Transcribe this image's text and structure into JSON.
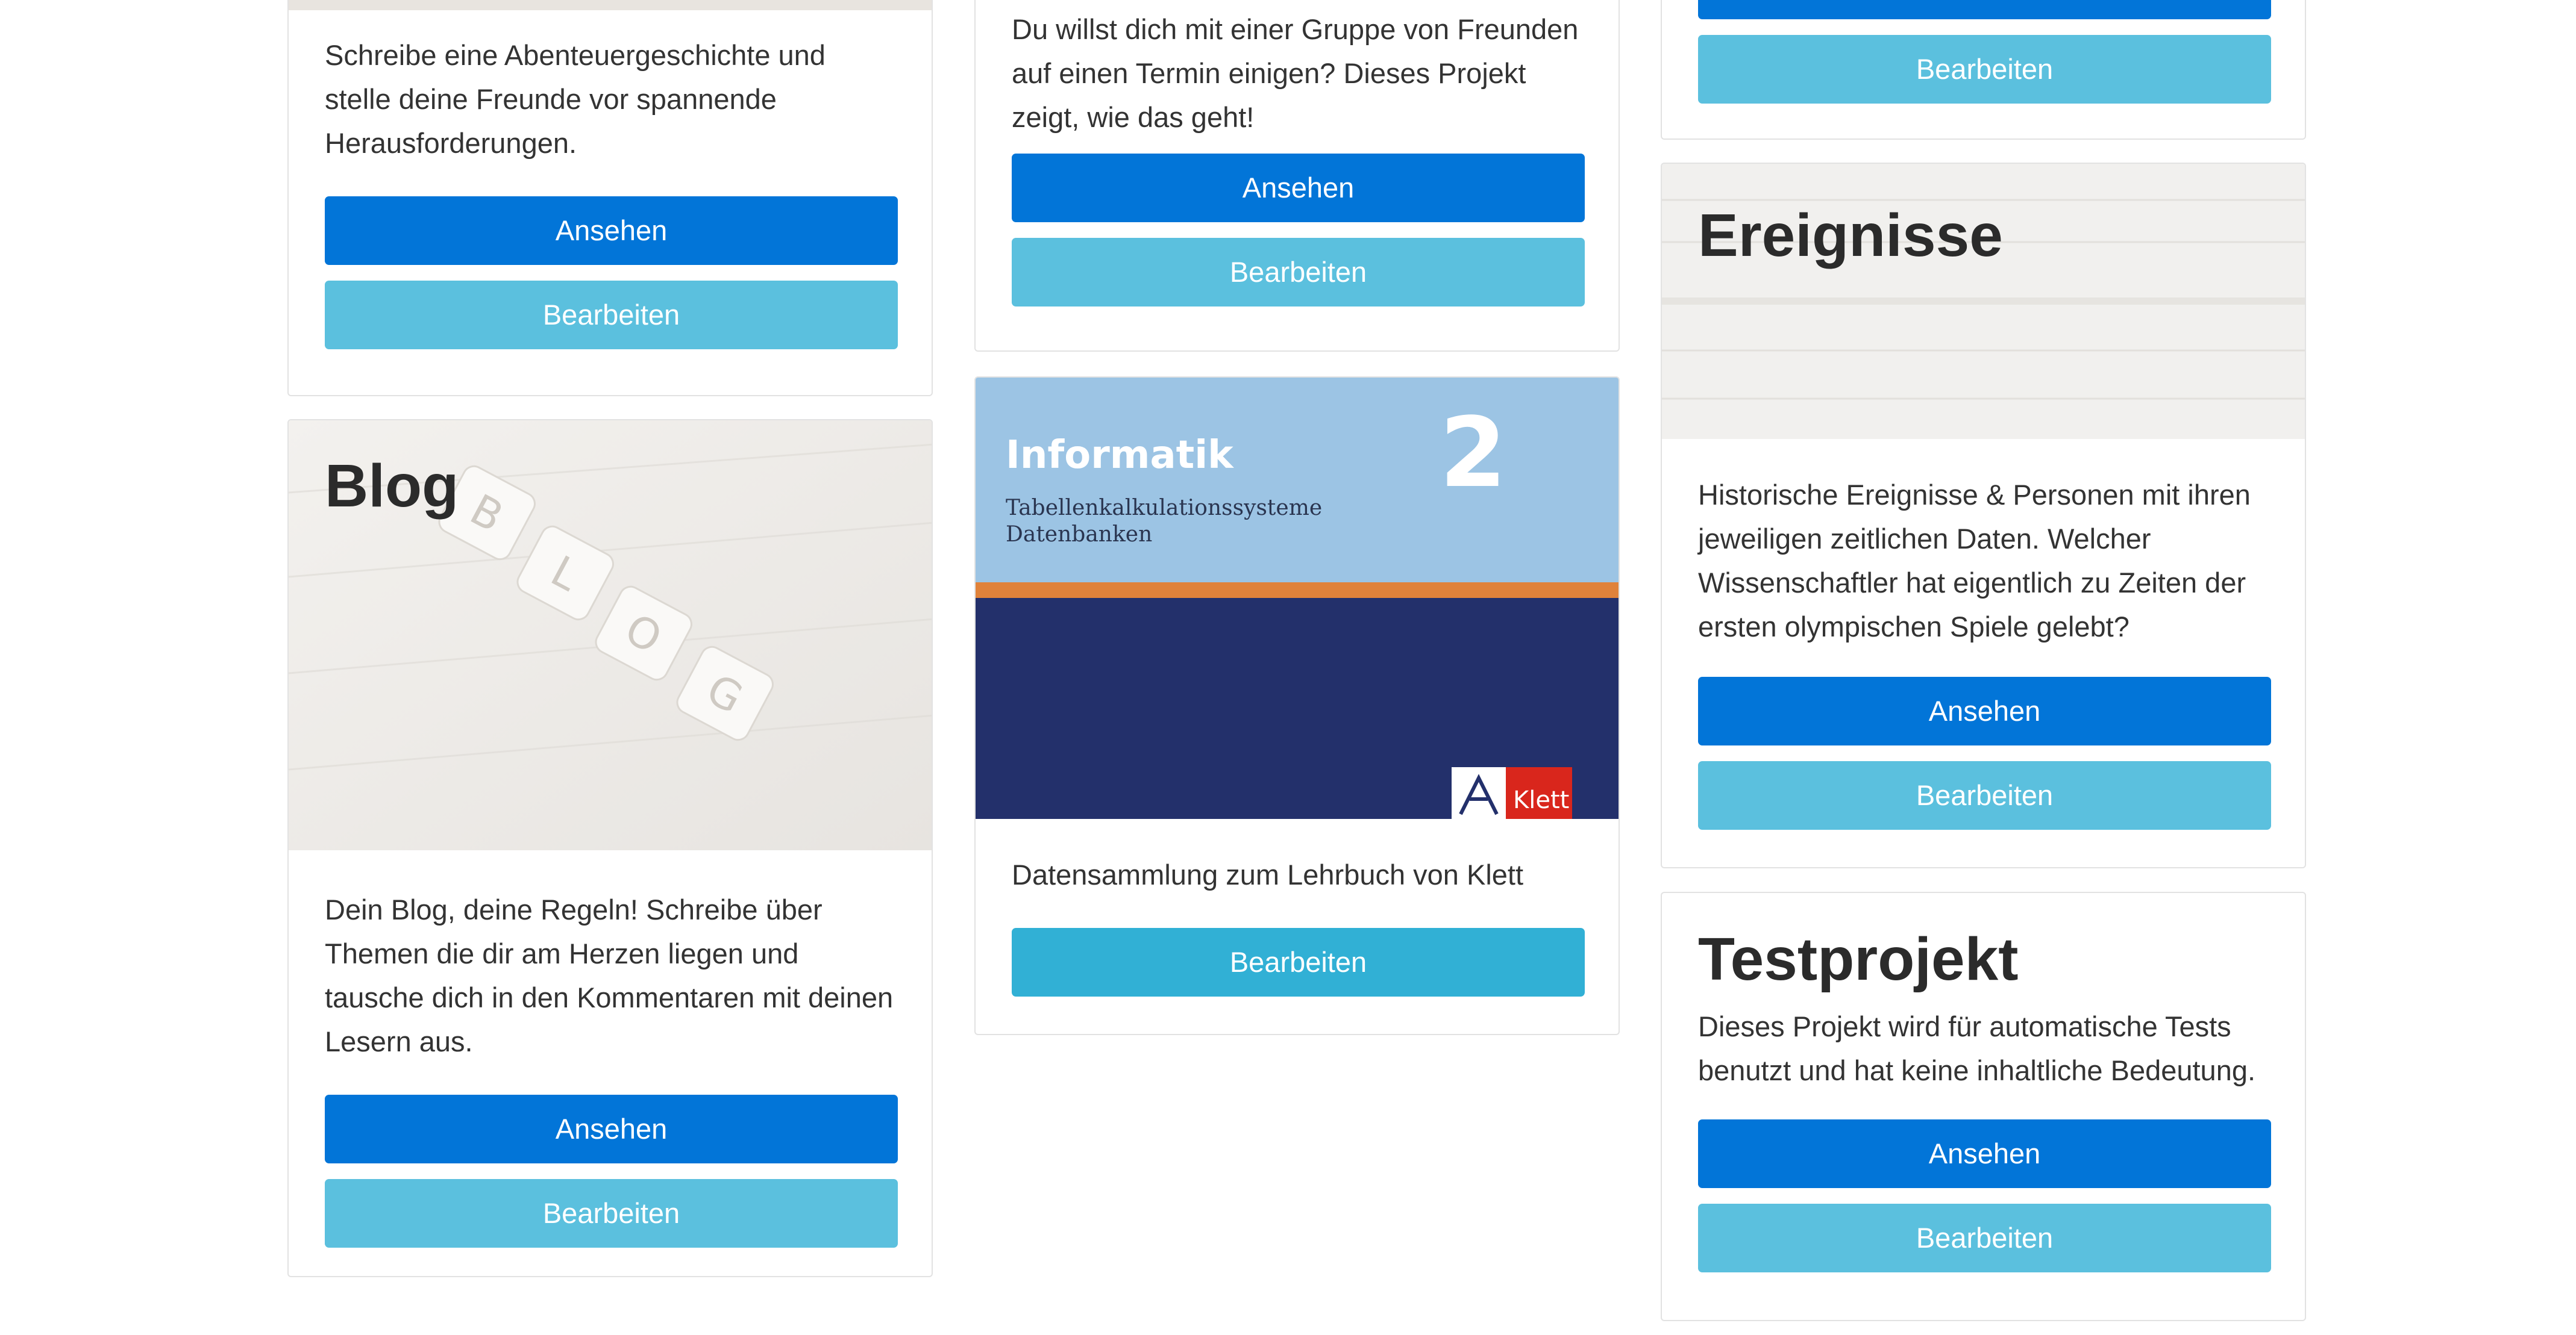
{
  "cards": {
    "adventure": {
      "description": "Schreibe eine Abenteuergeschichte und stelle deine Freunde vor spannende Herausforderungen.",
      "view_label": "Ansehen",
      "edit_label": "Bearbeiten"
    },
    "blog": {
      "title": "Blog",
      "image_tiles": [
        "B",
        "L",
        "O",
        "G"
      ],
      "description": "Dein Blog, deine Regeln! Schreibe über Themen die dir am Herzen liegen und tausche dich in den Kommentaren mit deinen Lesern aus.",
      "view_label": "Ansehen",
      "edit_label": "Bearbeiten"
    },
    "poll": {
      "description": "Du willst dich mit einer Gruppe von Freunden auf einen Termin einigen? Dieses Projekt zeigt, wie das geht!",
      "view_label": "Ansehen",
      "edit_label": "Bearbeiten"
    },
    "klett": {
      "cover_title": "Informatik",
      "cover_line1": "Tabellenkalkulationssysteme",
      "cover_line2": "Datenbanken",
      "cover_number": "2",
      "cover_publisher": "Klett",
      "description": "Datensammlung zum Lehrbuch von Klett",
      "edit_label": "Bearbeiten"
    },
    "top_right": {
      "edit_label": "Bearbeiten"
    },
    "events": {
      "title": "Ereignisse",
      "description": "Historische Ereignisse & Personen mit ihren jeweiligen zeitlichen Daten. Welcher Wissenschaftler hat eigentlich zu Zeiten der ersten olympischen Spiele gelebt?",
      "view_label": "Ansehen",
      "edit_label": "Bearbeiten"
    },
    "test": {
      "title": "Testprojekt",
      "description": "Dieses Projekt wird für automatische Tests benutzt und hat keine inhaltliche Bedeutung.",
      "view_label": "Ansehen",
      "edit_label": "Bearbeiten"
    }
  },
  "colors": {
    "primary": "#0275d8",
    "info": "#5bc0de",
    "info_strong": "#31b0d5",
    "klett_red": "#d9261c",
    "cover_blue": "#23306b",
    "cover_sky": "#9cc4e4"
  }
}
